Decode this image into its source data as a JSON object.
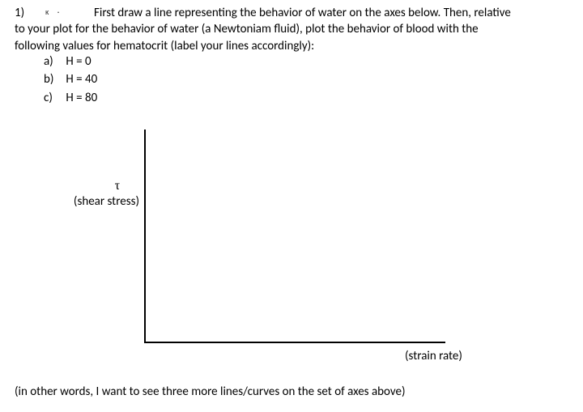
{
  "question_number": "1)",
  "small_mark": "ᴋ  ·",
  "prompt_line1": "First draw a line representing the behavior of water on the axes below.  Then, relative",
  "prompt_line2": "to your plot for the behavior of water (a Newtoniam fluid), plot the behavior of blood with the",
  "prompt_line3": "following values for hematocrit (label your lines accordingly):",
  "options": [
    {
      "letter": "a)",
      "text": "H = 0"
    },
    {
      "letter": "b)",
      "text": "H = 40"
    },
    {
      "letter": "c)",
      "text": "H = 80"
    }
  ],
  "axes": {
    "y_symbol": "τ",
    "y_label": "(shear stress)",
    "x_label": "(strain rate)"
  },
  "footer": "(in other words, I want to see three more lines/curves on the set of axes above)",
  "chart_data": {
    "type": "line",
    "title": "",
    "xlabel": "strain rate",
    "ylabel": "shear stress (τ)",
    "series": [],
    "note": "Empty axes — student is asked to draw water (Newtonian) line and three blood curves for H=0, H=40, H=80."
  }
}
